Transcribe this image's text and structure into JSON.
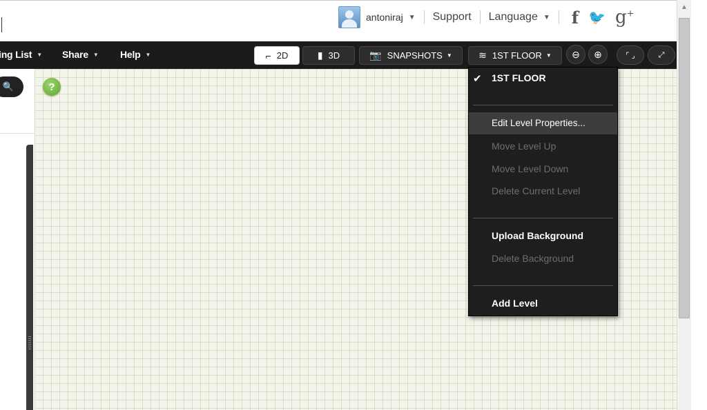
{
  "header": {
    "username": "antoniraj",
    "support_label": "Support",
    "language_label": "Language",
    "social": {
      "facebook": "f",
      "twitter": "🐦",
      "google": "g"
    }
  },
  "toolbar": {
    "menu": [
      {
        "label": "ing List"
      },
      {
        "label": "Share"
      },
      {
        "label": "Help"
      }
    ],
    "view_2d": "2D",
    "view_3d": "3D",
    "snapshots": "SNAPSHOTS",
    "floor": "1ST FLOOR"
  },
  "dropdown": {
    "current_level": "1ST FLOOR",
    "items": [
      {
        "label": "Edit Level Properties...",
        "enabled": true
      },
      {
        "label": "Move Level Up",
        "enabled": false
      },
      {
        "label": "Move Level Down",
        "enabled": false
      },
      {
        "label": "Delete Current Level",
        "enabled": false
      },
      {
        "label": "Upload Background",
        "enabled": true
      },
      {
        "label": "Delete Background",
        "enabled": false
      },
      {
        "label": "Add Level",
        "enabled": true
      }
    ]
  },
  "help_badge": "?",
  "colors": {
    "toolbar": "#1b1b1b",
    "menu_bg": "#1e1e1e",
    "grid": "#d9ddc7",
    "help": "#6bb536"
  }
}
